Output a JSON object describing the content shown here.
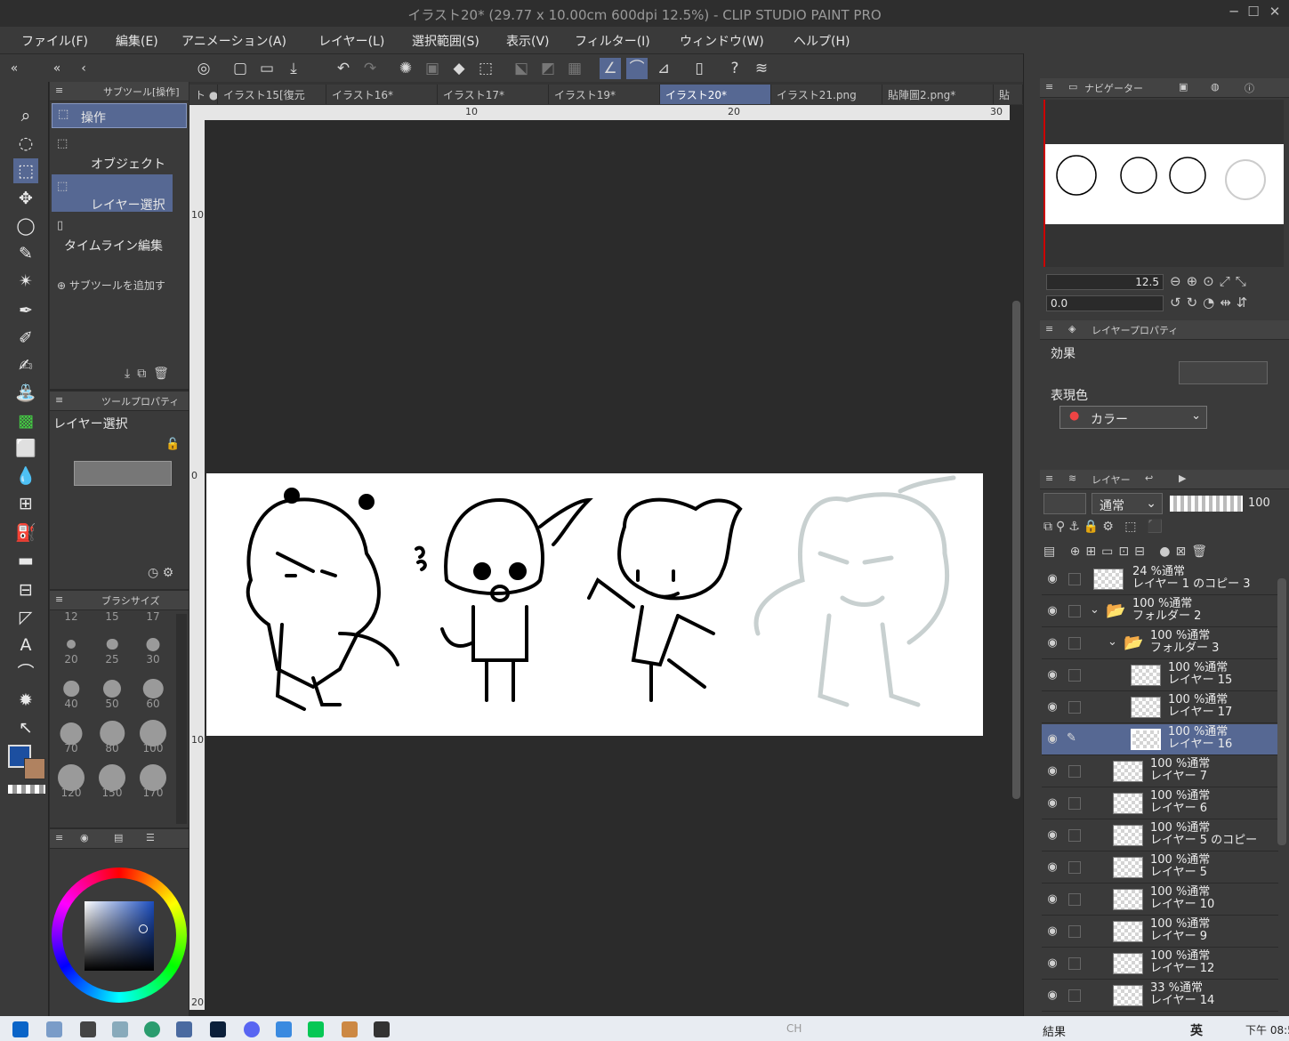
{
  "window": {
    "title": "イラスト20* (29.77 x 10.00cm 600dpi 12.5%)  - CLIP STUDIO PAINT PRO",
    "min": "─",
    "max": "☐",
    "close": "✕"
  },
  "menu": [
    "ファイル(F)",
    "編集(E)",
    "アニメーション(A)",
    "レイヤー(L)",
    "選択範囲(S)",
    "表示(V)",
    "フィルター(I)",
    "ウィンドウ(W)",
    "ヘルプ(H)"
  ],
  "tabs": [
    "ト",
    "イラスト15[復元",
    "イラスト16*",
    "イラスト17*",
    "イラスト19*",
    "イラスト20*",
    "イラスト21.png",
    "貼陣圖2.png*",
    "貼"
  ],
  "ruler": {
    "h": [
      "10",
      "20",
      "30"
    ],
    "v": [
      "10",
      "0",
      "10",
      "20"
    ]
  },
  "subtool": {
    "header": "サブツール[操作]",
    "items": [
      "操作",
      "オブジェクト",
      "レイヤー選択",
      "タイムライン編集"
    ],
    "add": "サブツールを追加す"
  },
  "toolprop": {
    "header": "ツールプロパティ",
    "name": "レイヤー選択"
  },
  "brushsize": {
    "header": "ブラシサイズ",
    "top": [
      "12",
      "15",
      "17"
    ],
    "sizes": [
      "20",
      "25",
      "30",
      "40",
      "50",
      "60",
      "70",
      "80",
      "100",
      "120",
      "150",
      "170"
    ]
  },
  "navigator": {
    "header": "ナビゲーター",
    "zoom": "12.5",
    "angle": "0.0"
  },
  "layerprop": {
    "header": "レイヤープロパティ",
    "effect": "効果",
    "expr": "表現色",
    "color": "カラー"
  },
  "layers": {
    "header": "レイヤー",
    "blend": "通常",
    "opacity": "100",
    "rows": [
      {
        "pct": "24 %通常",
        "name": "レイヤー 1 のコピー 3"
      },
      {
        "pct": "100 %通常",
        "name": "フォルダー 2"
      },
      {
        "pct": "100 %通常",
        "name": "フォルダー 3"
      },
      {
        "pct": "100 %通常",
        "name": "レイヤー 15"
      },
      {
        "pct": "100 %通常",
        "name": "レイヤー 17"
      },
      {
        "pct": "100 %通常",
        "name": "レイヤー 16"
      },
      {
        "pct": "100 %通常",
        "name": "レイヤー 7"
      },
      {
        "pct": "100 %通常",
        "name": "レイヤー 6"
      },
      {
        "pct": "100 %通常",
        "name": "レイヤー 5 のコピー"
      },
      {
        "pct": "100 %通常",
        "name": "レイヤー 5"
      },
      {
        "pct": "100 %通常",
        "name": "レイヤー 10"
      },
      {
        "pct": "100 %通常",
        "name": "レイヤー 9"
      },
      {
        "pct": "100 %通常",
        "name": "レイヤー 12"
      },
      {
        "pct": "33 %通常",
        "name": "レイヤー 14"
      }
    ]
  },
  "taskbar": {
    "ime": "結果",
    "lang": "英",
    "time": "下午 08:5",
    "ch": "CH"
  },
  "colors": {
    "main": "#1c4fa0",
    "sub": "#b08260"
  }
}
